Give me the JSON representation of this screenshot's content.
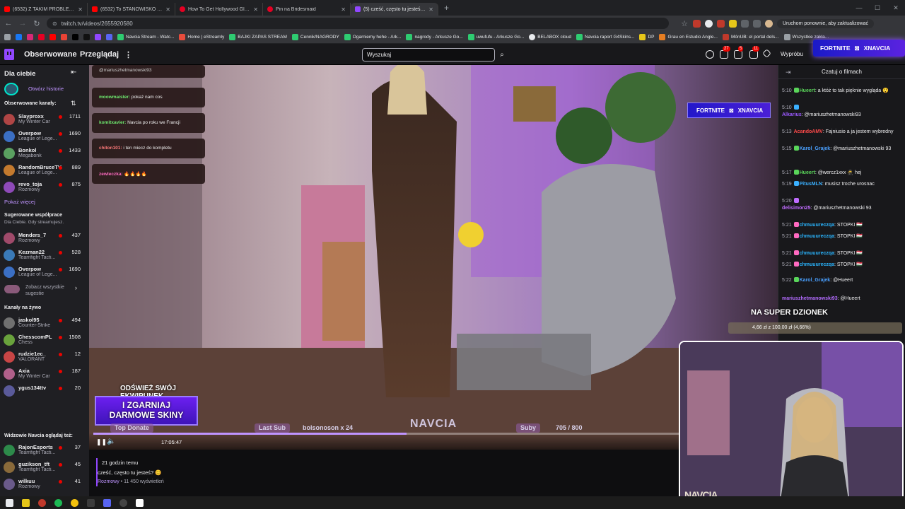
{
  "browser": {
    "tabs": [
      {
        "title": "(6532) Z TAKIM PROBLEMEM KO",
        "color": "#ff0000"
      },
      {
        "title": "(6532) To STANOWISKO Mołregó",
        "color": "#ff0000"
      },
      {
        "title": "How To Get Hollywood Glam Wa",
        "color": "#e60023"
      },
      {
        "title": "Pin na Bridesmaid",
        "color": "#e60023"
      },
      {
        "title": "(5) cześć, często tu jesteś? 😊 - Tw",
        "color": "#9147ff"
      }
    ],
    "new_tab": "+",
    "url": "twitch.tv/videos/2655920580",
    "update_button": "Uruchom ponownie, aby zaktualizować",
    "bookmarks": [
      "Navcia Stream - Watc...",
      "Home | eStreamly",
      "BAJKI ZAPAS STREAM",
      "Cennik/NAGRODY",
      "Ogarniemy hehe - Ark...",
      "nagrody - Arkusze Go...",
      "uwufufu - Arkusze Go...",
      "BELABOX cloud",
      "Navcia raport G4Skins...",
      "DP",
      "Grau en Estudio Angle...",
      "MónUB: el portal dels...",
      "Wszystkie zakła..."
    ]
  },
  "twitch": {
    "nav_following": "Obserwowane",
    "nav_browse": "Przeglądaj",
    "more": "⋮",
    "search_placeholder": "Wyszukaj",
    "badges": {
      "inbox": "27",
      "notif": "5",
      "whispers": "11"
    },
    "get_ads_free": "Wypróbu",
    "fortnite_banner": {
      "game": "FORTNITE",
      "sep": "⊠",
      "name": "XNAVCIA"
    }
  },
  "sidebar": {
    "for_you": "Dla ciebie",
    "collapse": "⇤",
    "open_stories": "Otwórz historie",
    "followed_header": "Obserwowane kanały:",
    "followed": [
      {
        "name": "Slayproxx",
        "game": "My Winter Car",
        "viewers": "1711",
        "color": "#b04545"
      },
      {
        "name": "Overpow",
        "game": "League of Lege...",
        "viewers": "1690",
        "color": "#3b6fc4"
      },
      {
        "name": "Bonkol",
        "game": "Megabonk",
        "viewers": "1433",
        "color": "#5aa060"
      },
      {
        "name": "RandomBruceTV",
        "game": "League of Lege...",
        "viewers": "889",
        "color": "#c47a2e"
      },
      {
        "name": "revo_toja",
        "game": "Rozmowy",
        "viewers": "875",
        "color": "#8e4ab8"
      }
    ],
    "show_more": "Pokaż więcej",
    "suggested_header": "Sugerowane współprace",
    "suggested_sub": "Dla Ciebie. Gdy streamujesz.",
    "suggested": [
      {
        "name": "Menders_7",
        "game": "Rozmowy",
        "viewers": "437",
        "color": "#a04a6a"
      },
      {
        "name": "Kezman22",
        "game": "Teamfight Tacti...",
        "viewers": "528",
        "color": "#3a7ab8"
      },
      {
        "name": "Overpow",
        "game": "League of Lege...",
        "viewers": "1690",
        "color": "#3b6fc4"
      }
    ],
    "see_all": "Zobacz wszystkie sugestie",
    "live_header": "Kanały na żywo",
    "live": [
      {
        "name": "jaskol95",
        "game": "Counter-Strike",
        "viewers": "494",
        "color": "#707070"
      },
      {
        "name": "ChesscomPL",
        "game": "Chess",
        "viewers": "1508",
        "color": "#69a23c"
      },
      {
        "name": "rudzie1ec_",
        "game": "VALORANT",
        "viewers": "12",
        "color": "#c84545"
      },
      {
        "name": "Axia",
        "game": "My Winter Car",
        "viewers": "187",
        "color": "#b0608a"
      },
      {
        "name": "ygus134ttv",
        "game": "",
        "viewers": "20",
        "color": "#5a5a9a"
      }
    ],
    "also_watch_header": "Widzowie Navcia oglądaj też:",
    "also_watch": [
      {
        "name": "RajonEsports",
        "game": "Teamfight Tacti...",
        "viewers": "37",
        "color": "#2d8a4a"
      },
      {
        "name": "guzikson_tft",
        "game": "Teamfight Tacti...",
        "viewers": "45",
        "color": "#8a6a3a"
      },
      {
        "name": "wilkuu",
        "game": "Rozmowy",
        "viewers": "41",
        "color": "#6a5a8a"
      }
    ]
  },
  "player": {
    "overlay_chat": [
      {
        "user": "@mariuszhetmanowski93",
        "text": ""
      },
      {
        "user": "moowmaister:",
        "text": "pokaż nam cos"
      },
      {
        "user": "komitxavier:",
        "text": "Navcia po roku we Francji"
      },
      {
        "user": "chiton101:",
        "text": "i ten miecz do kompletu"
      },
      {
        "user": "zewleczka:",
        "text": "🔥🔥🔥🔥"
      }
    ],
    "fortnite_overlay": {
      "game": "FORTNITE",
      "sep": "⊠",
      "name": "XNAVCIA"
    },
    "refresh_text_1": "ODŚWIEŻ SWÓJ",
    "refresh_text_2": "EKWIPUNEK",
    "promo_1": "I ZGARNIAJ",
    "promo_2": "DARMOWE SKINY",
    "top_donate": "Top Donate",
    "last_sub_label": "Last Sub",
    "last_sub_value": "bolsonoson x 24",
    "brand": "NAVCIA",
    "subs_label": "Suby",
    "subs_value": "705 / 800",
    "progress": 0.46,
    "play": "❚❚",
    "volume": "🔈",
    "time": "17:05:47"
  },
  "video": {
    "ago": "21 godzin temu",
    "title": "cześć, często tu jesteś? 😊",
    "category": "Rozmowy",
    "views": " • 11 450 wyświetleń"
  },
  "chat": {
    "header": "Czatuj o filmach",
    "collapse": "⇥",
    "messages": [
      {
        "t": "5:10",
        "user": "Hueert",
        "color": "#5ad65a",
        "text": ": a któż to tak pięknie wygląda 😲"
      },
      {
        "t": "5:10",
        "user": "",
        "color": "#efeff1",
        "text": ""
      },
      {
        "t": "",
        "user": "Alkarius",
        "color": "#9b59ff",
        "text": ": @mariuszhetmanowski93"
      },
      {
        "t": "5:13",
        "user": "AcandoAMV",
        "color": "#ff4a4a",
        "text": ": Fajniusio a ja jestem wybredny"
      },
      {
        "t": "5:15",
        "user": "Karol_Grajek",
        "color": "#4aa0ff",
        "text": ": @mariuszhetmanowski 93"
      },
      {
        "t": "5:17",
        "user": "Hueert",
        "color": "#5ad65a",
        "text": ": @wercz1xxx 🥷 hej"
      },
      {
        "t": "5:19",
        "user": "PitusMLN",
        "color": "#3ab0ff",
        "text": ": musisz troche urosnac"
      },
      {
        "t": "5:20",
        "user": "",
        "color": "#efeff1",
        "text": ""
      },
      {
        "t": "",
        "user": "delisimon25",
        "color": "#c06cff",
        "text": ": @mariuszhetmanowski 93"
      },
      {
        "t": "5:21",
        "user": "chmuuureczqa",
        "color": "#2ab5ff",
        "text": ": STOPKI 🇭🇺"
      },
      {
        "t": "5:21",
        "user": "chmuuureczqa",
        "color": "#2ab5ff",
        "text": ": STOPKI 🇭🇺"
      },
      {
        "t": "5:21",
        "user": "chmuuureczqa",
        "color": "#2ab5ff",
        "text": ": STOPKI 🇭🇺"
      },
      {
        "t": "5:21",
        "user": "chmuuureczqa",
        "color": "#2ab5ff",
        "text": ": STOPKI 🇭🇺"
      },
      {
        "t": "5:22",
        "user": "Karol_Grajek",
        "color": "#4aa0ff",
        "text": ": @Hueert"
      },
      {
        "t": "",
        "user": "mariuszhetmanowski93",
        "color": "#b36cff",
        "text": ": @Hueert"
      }
    ]
  },
  "stream_overlay": {
    "super_heading": "NA SUPER DZIONEK",
    "goal_text": "4,66 zł z 100,00 zł (4,66%)",
    "cam_brand": "NAVCIA"
  },
  "taskbar": {
    "icons": [
      "start",
      "explorer",
      "opera",
      "spotify",
      "chrome",
      "terminal",
      "discord",
      "obs",
      "capcut"
    ]
  }
}
